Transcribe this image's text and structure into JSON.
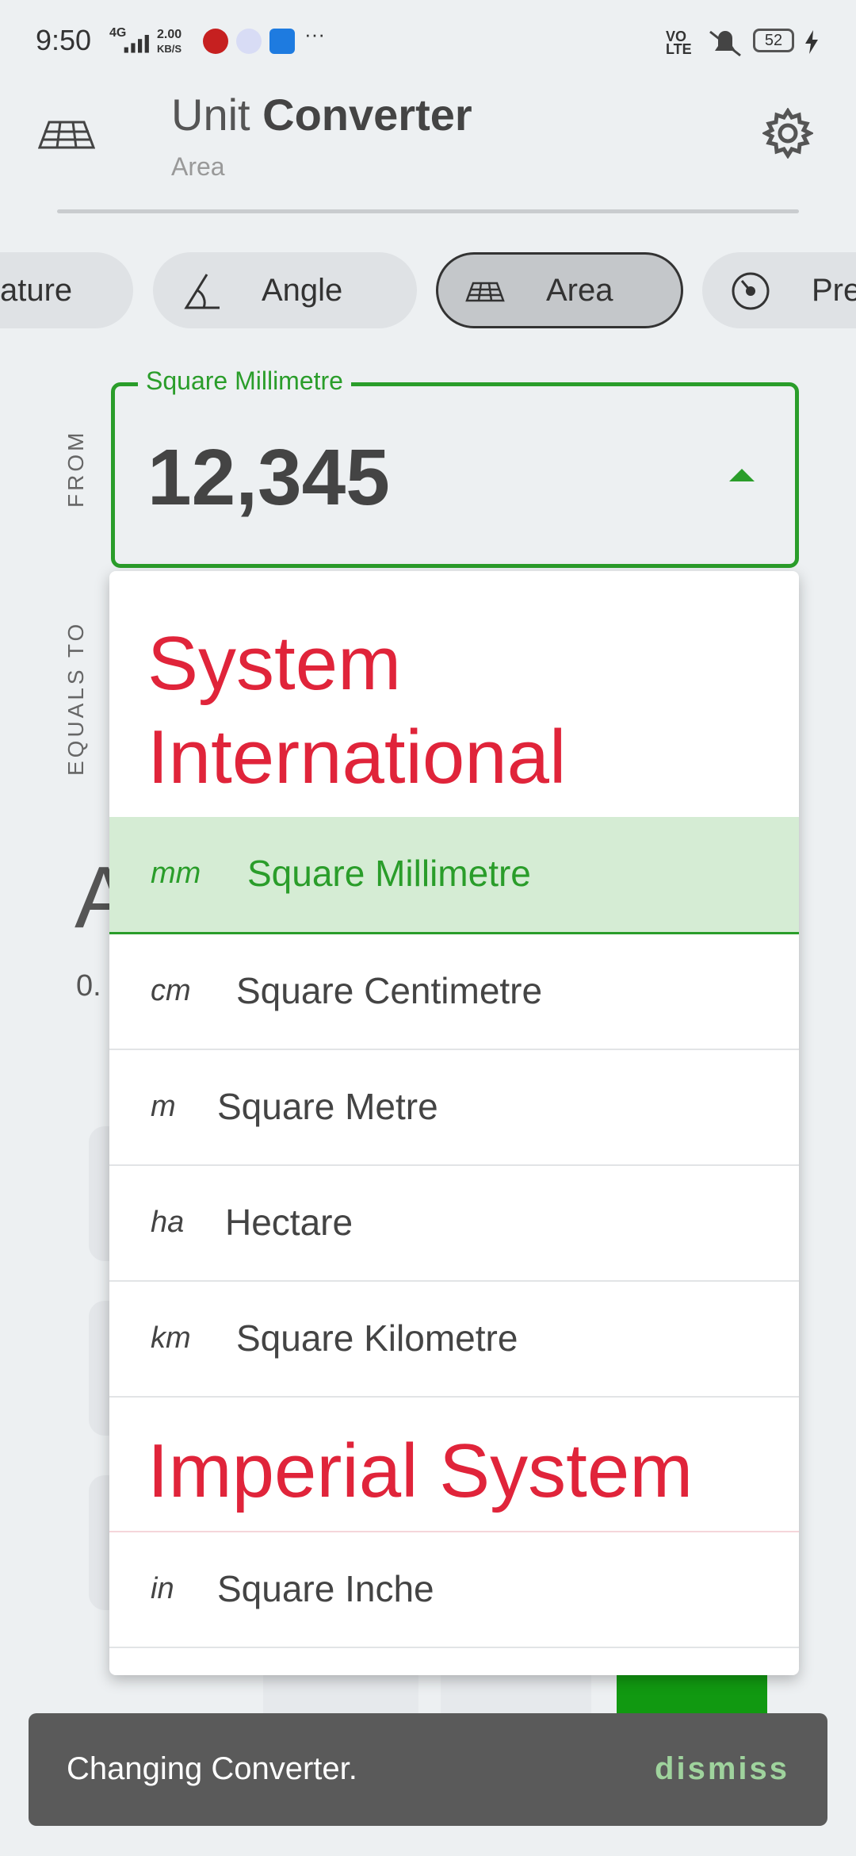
{
  "status_bar": {
    "time": "9:50",
    "network": "4G",
    "speed_value": "2.00",
    "speed_unit": "KB/S",
    "more": "···",
    "volte": "VO LTE",
    "battery": "52"
  },
  "header": {
    "title_light": "Unit",
    "title_bold": "Converter",
    "subtitle": "Area"
  },
  "chips": [
    {
      "label": "ature",
      "icon": "thermometer-icon"
    },
    {
      "label": "Angle",
      "icon": "angle-icon"
    },
    {
      "label": "Area",
      "icon": "area-grid-icon"
    },
    {
      "label": "Pre",
      "icon": "pressure-gauge-icon"
    }
  ],
  "side_labels": {
    "from": "FROM",
    "equals_to": "EQUALS TO"
  },
  "from_field": {
    "unit_label": "Square Millimetre",
    "value": "12,345"
  },
  "background": {
    "result_letter": "A",
    "result_value": "0."
  },
  "menu": {
    "groups": [
      {
        "title_line1": "System",
        "title_line2": "International"
      },
      {
        "title_line1": "Imperial System"
      }
    ],
    "items": [
      {
        "symbol": "mm",
        "name": "Square Millimetre",
        "selected": true
      },
      {
        "symbol": "cm",
        "name": "Square Centimetre"
      },
      {
        "symbol": "m",
        "name": "Square Metre"
      },
      {
        "symbol": "ha",
        "name": "Hectare"
      },
      {
        "symbol": "km",
        "name": "Square Kilometre"
      },
      {
        "symbol": "in",
        "name": "Square Inche"
      }
    ]
  },
  "snackbar": {
    "message": "Changing Converter.",
    "action": "dismiss"
  },
  "colors": {
    "accent_green": "#2a9d2a",
    "group_red": "#e0243a",
    "selected_bg": "#d5ecd4"
  }
}
